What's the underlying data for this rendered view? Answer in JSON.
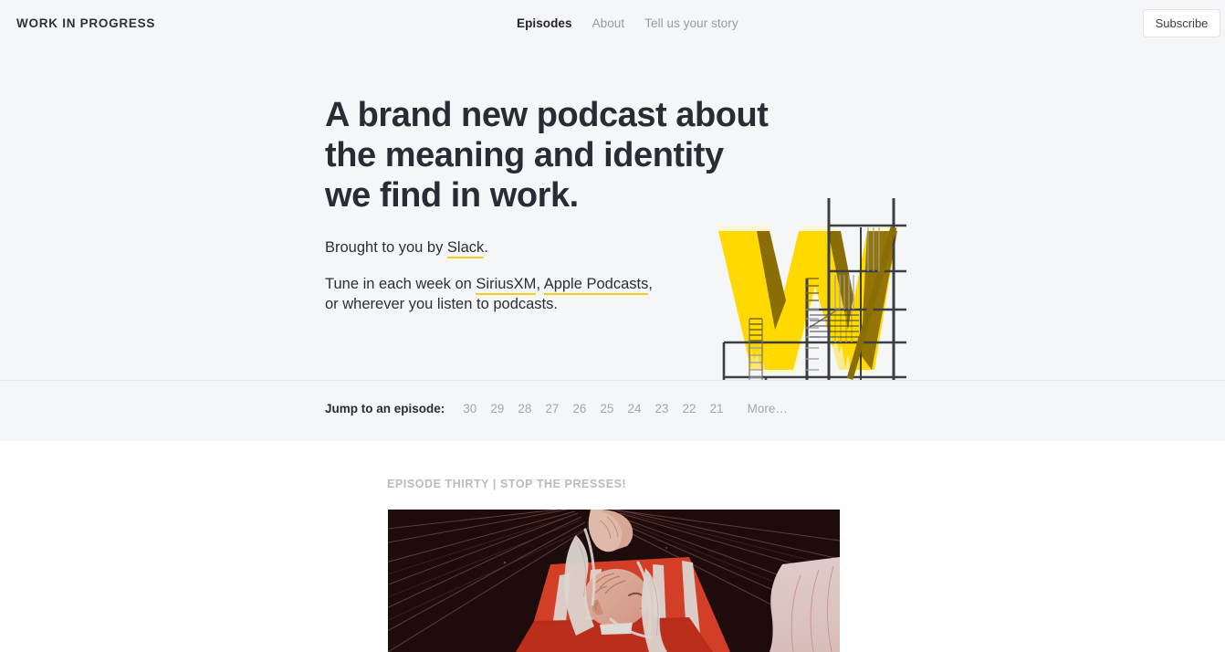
{
  "header": {
    "brand": "WORK IN PROGRESS",
    "nav": [
      {
        "label": "Episodes",
        "active": true
      },
      {
        "label": "About",
        "active": false
      },
      {
        "label": "Tell us your story",
        "active": false
      }
    ],
    "subscribe_label": "Subscribe"
  },
  "hero": {
    "title_line1": "A brand new podcast about",
    "title_line2": "the meaning and identity",
    "title_line3": "we find in work.",
    "sponsor_prefix": "Brought to you by ",
    "sponsor_link": "Slack",
    "sponsor_suffix": ".",
    "tune_prefix": "Tune in each week on ",
    "tune_link1": "SiriusXM",
    "tune_sep": ", ",
    "tune_link2": "Apple Podcasts",
    "tune_suffix": ",",
    "tune_line2": "or wherever you listen to podcasts.",
    "art_name": "yellow-w-scaffolding-illustration"
  },
  "jump": {
    "label": "Jump to an episode:",
    "episodes": [
      "30",
      "29",
      "28",
      "27",
      "26",
      "25",
      "24",
      "23",
      "22",
      "21"
    ],
    "more_label": "More…"
  },
  "episode": {
    "kicker": "EPISODE THIRTY | STOP THE PRESSES!",
    "art_name": "sleeping-person-illustration"
  },
  "colors": {
    "page_bg": "#f5f6f8",
    "section_bg": "#ffffff",
    "text": "#2b2b33",
    "muted": "#9a9aa4",
    "accent_yellow": "#f3d117",
    "logo_yellow": "#ffd900",
    "scaffold_dark": "#3b3f45",
    "illustration_red": "#e8442a",
    "illustration_dark": "#1c0d0d",
    "border": "#e6e7eb"
  }
}
